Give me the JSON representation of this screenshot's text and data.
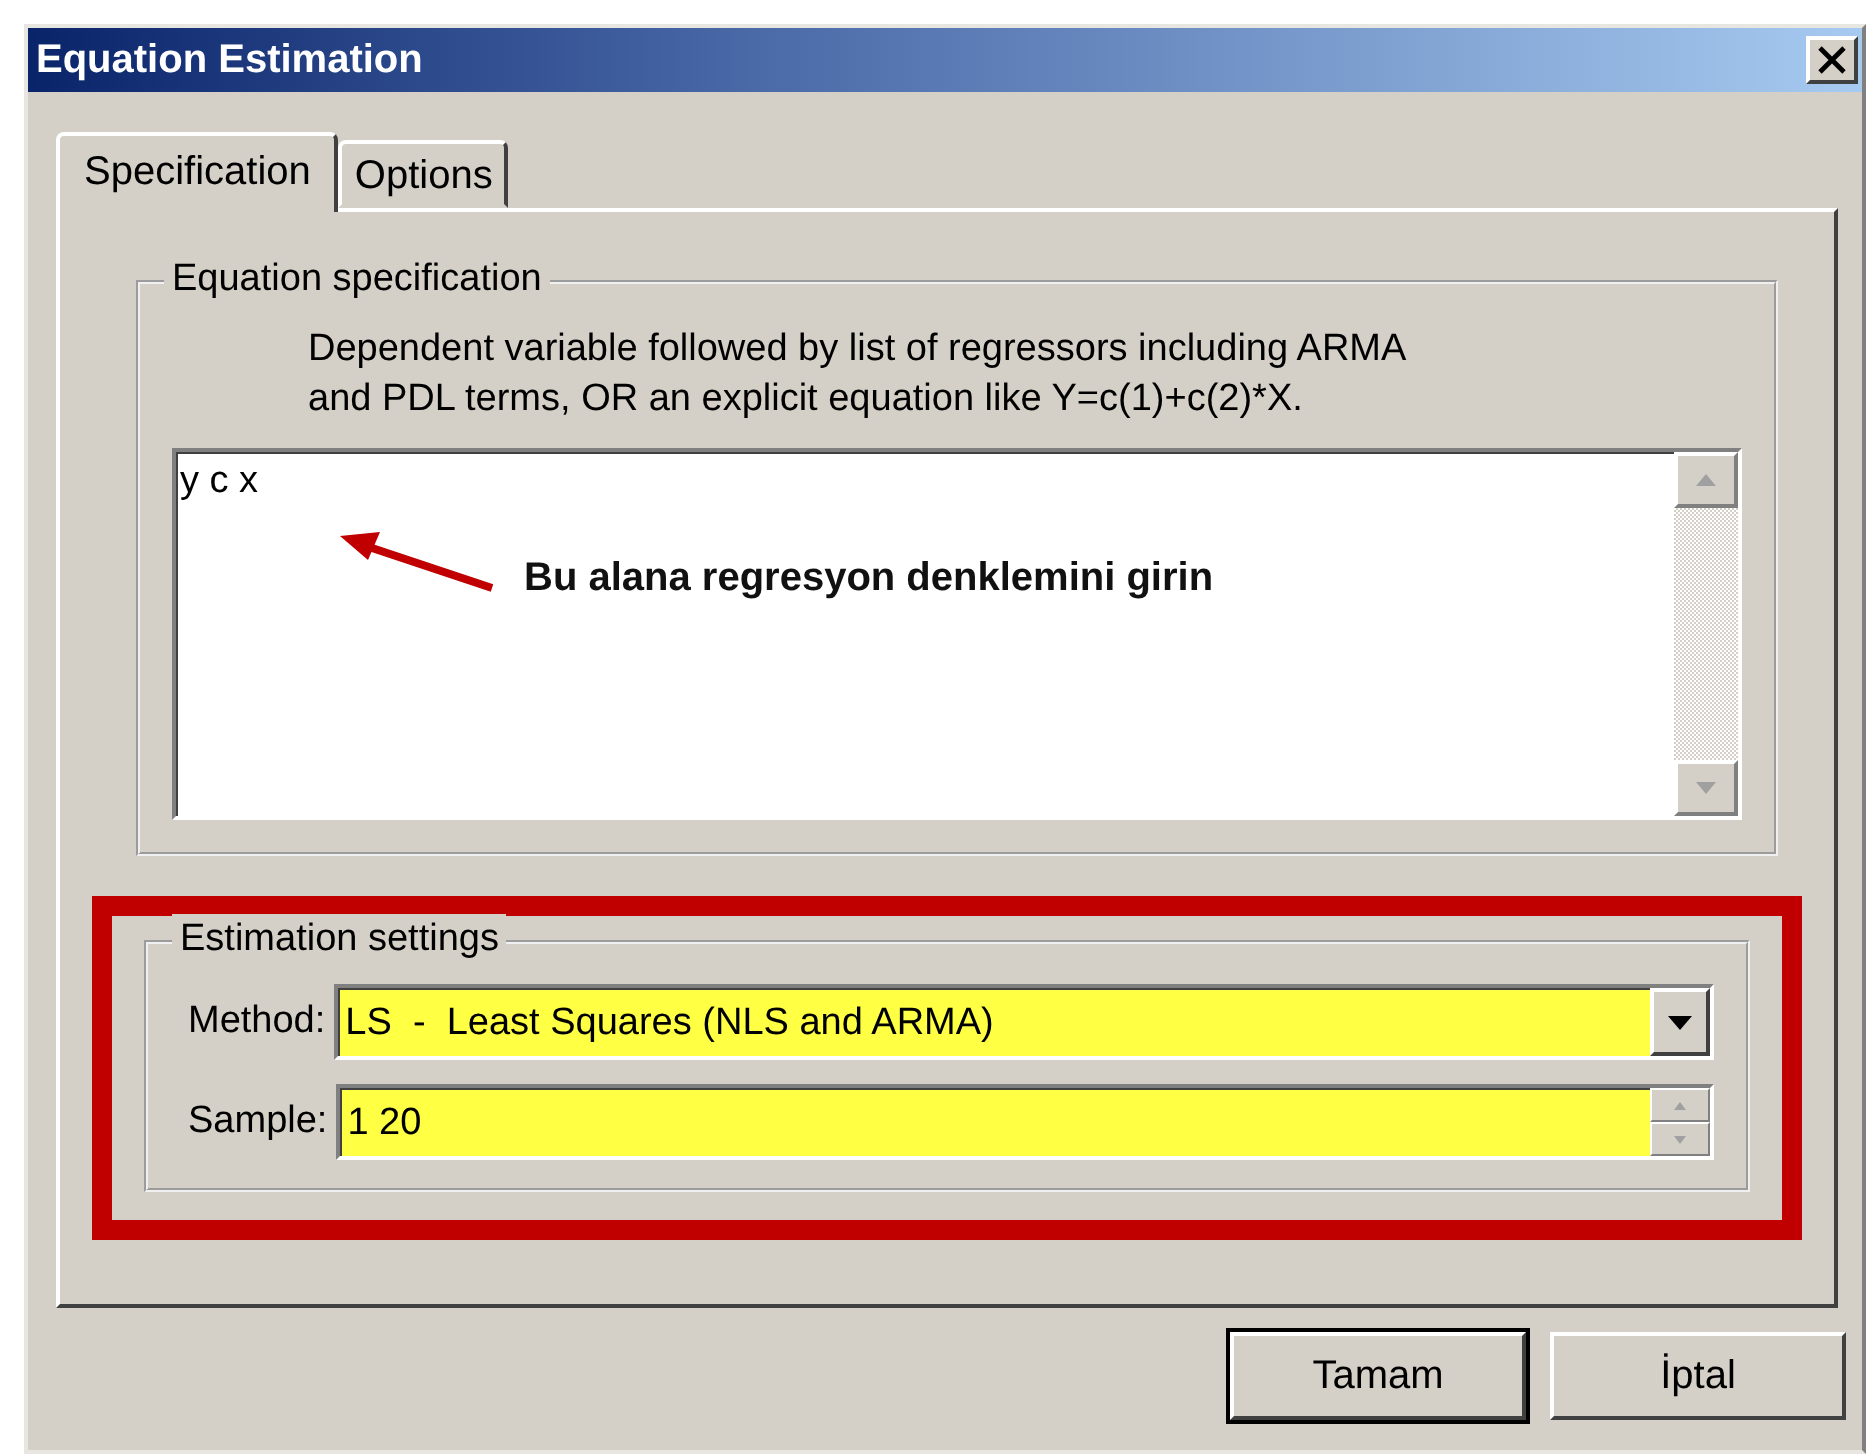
{
  "window": {
    "title": "Equation Estimation"
  },
  "tabs": [
    {
      "label": "Specification",
      "selected": true
    },
    {
      "label": "Options",
      "selected": false
    }
  ],
  "equation_specification": {
    "title": "Equation specification",
    "hint_lines": [
      "Dependent variable followed by list of regressors including ARMA",
      "and PDL terms, OR an explicit equation like Y=c(1)+c(2)*X."
    ],
    "value": "y c x",
    "annotation": "Bu alana regresyon denklemini girin"
  },
  "estimation_settings": {
    "title": "Estimation settings",
    "highlighted": true,
    "method": {
      "label": "Method:",
      "value": "LS  -  Least Squares (NLS and ARMA)"
    },
    "sample": {
      "label": "Sample:",
      "value": "1 20"
    }
  },
  "buttons": [
    {
      "label": "Tamam",
      "default": true
    },
    {
      "label": "İptal",
      "default": false
    }
  ]
}
